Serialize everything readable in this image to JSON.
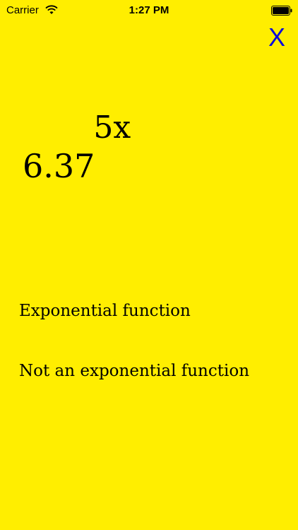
{
  "status_bar": {
    "carrier": "Carrier",
    "time": "1:27 PM"
  },
  "close_button": {
    "label": "X",
    "color": "#0a0adc"
  },
  "question": {
    "base": "6.37",
    "exponent": "5x"
  },
  "options": [
    {
      "label": "Exponential function"
    },
    {
      "label": "Not an exponential function"
    }
  ],
  "colors": {
    "background": "#ffee00",
    "text": "#000000"
  }
}
